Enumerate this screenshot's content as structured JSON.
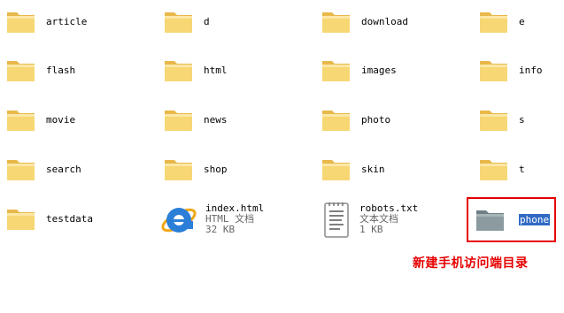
{
  "folders": [
    {
      "name": "article"
    },
    {
      "name": "d"
    },
    {
      "name": "download"
    },
    {
      "name": "e"
    },
    {
      "name": "flash"
    },
    {
      "name": "html"
    },
    {
      "name": "images"
    },
    {
      "name": "info"
    },
    {
      "name": "movie"
    },
    {
      "name": "news"
    },
    {
      "name": "photo"
    },
    {
      "name": "s"
    },
    {
      "name": "search"
    },
    {
      "name": "shop"
    },
    {
      "name": "skin"
    },
    {
      "name": "t"
    },
    {
      "name": "testdata"
    }
  ],
  "files": {
    "index": {
      "name": "index.html",
      "type": "HTML 文档",
      "size": "32 KB"
    },
    "robots": {
      "name": "robots.txt",
      "type": "文本文档",
      "size": "1 KB"
    }
  },
  "selected_folder": {
    "name": "phone"
  },
  "annotation": "新建手机访问端目录",
  "colors": {
    "folder": "#f6d36b",
    "selection": "#316ac5",
    "annotation": "#e60000"
  }
}
